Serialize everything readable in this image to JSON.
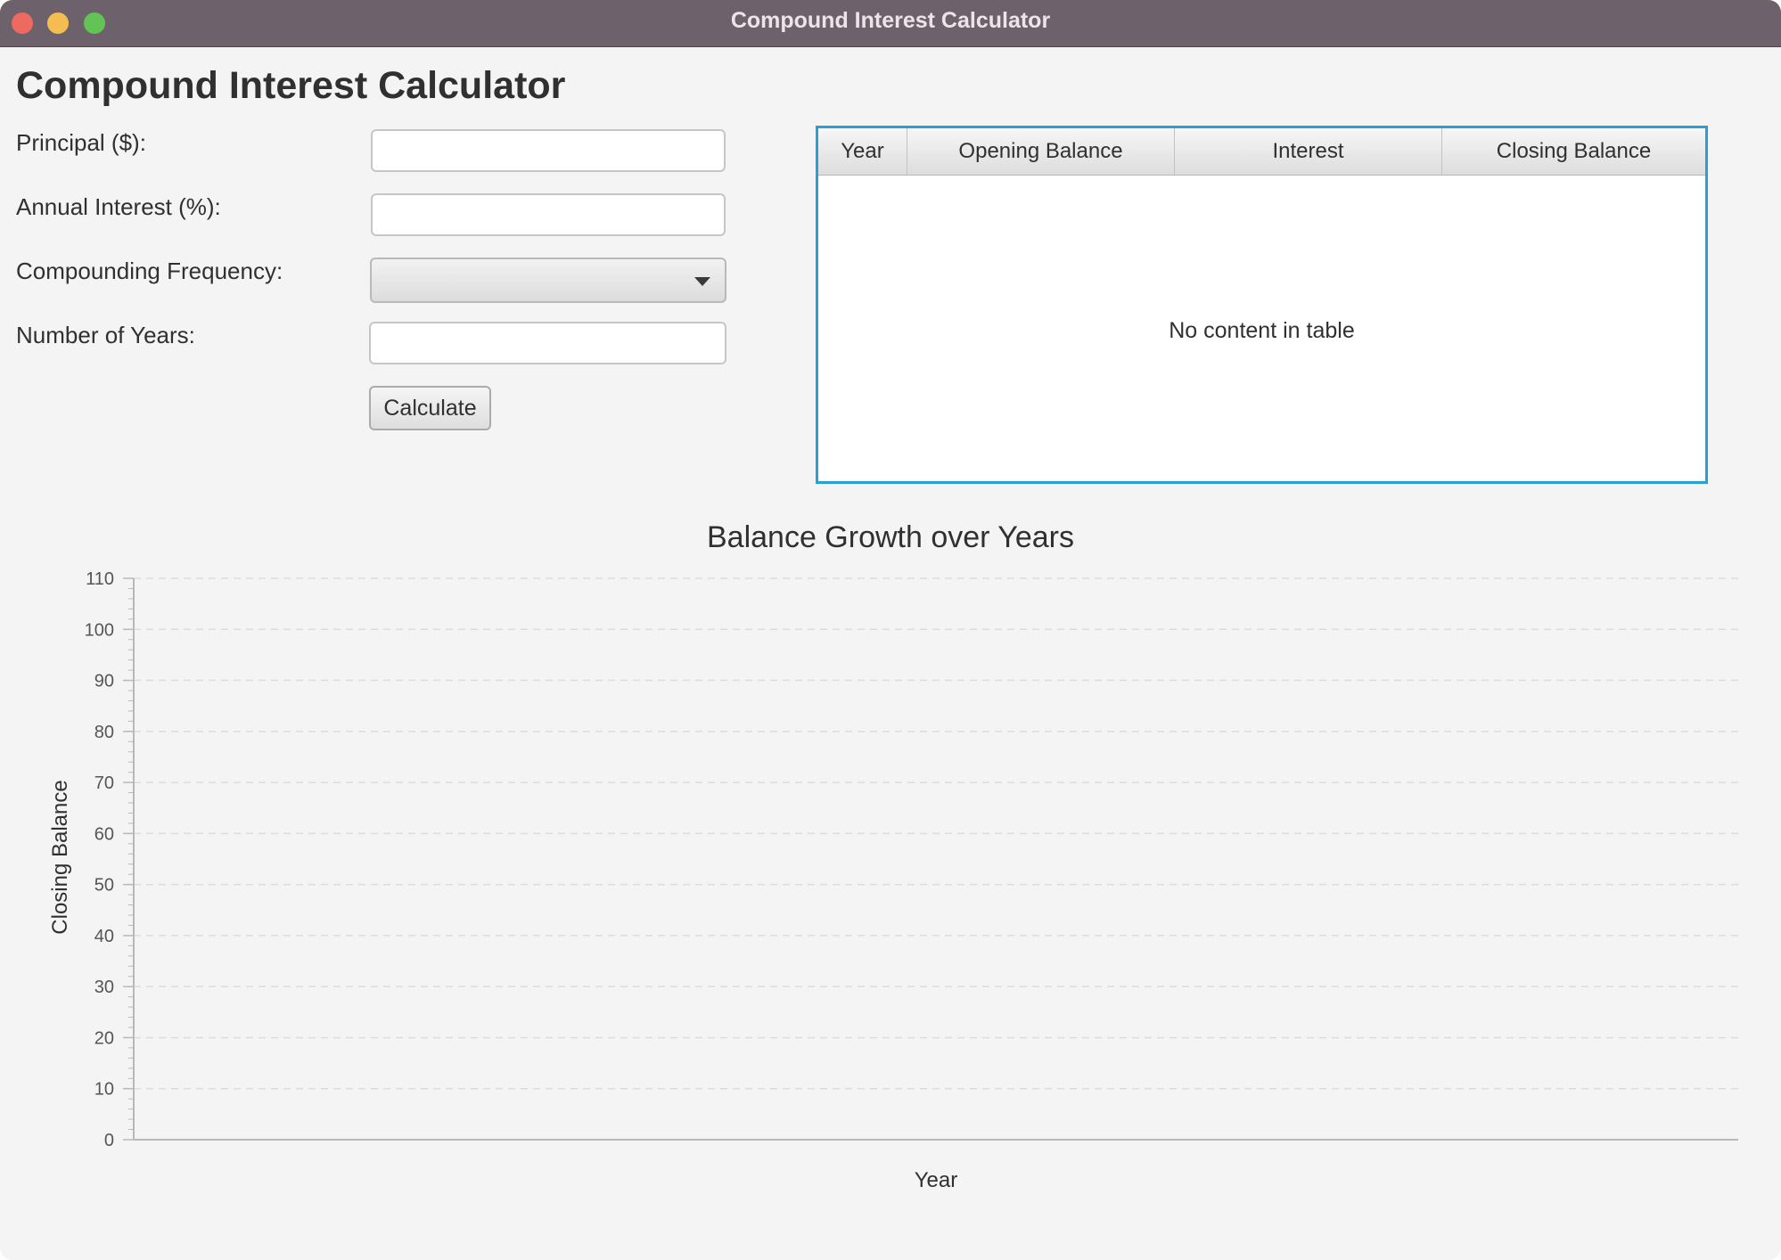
{
  "window": {
    "title": "Compound Interest Calculator"
  },
  "app": {
    "heading": "Compound Interest Calculator"
  },
  "form": {
    "principal_label": "Principal ($):",
    "principal_value": "",
    "interest_label": "Annual Interest (%):",
    "interest_value": "",
    "frequency_label": "Compounding Frequency:",
    "frequency_value": "",
    "years_label": "Number of Years:",
    "years_value": "",
    "calculate_label": "Calculate"
  },
  "table": {
    "columns": [
      "Year",
      "Opening Balance",
      "Interest",
      "Closing Balance"
    ],
    "rows": [],
    "empty_message": "No content in table"
  },
  "chart_data": {
    "type": "line",
    "title": "Balance Growth over Years",
    "xlabel": "Year",
    "ylabel": "Closing Balance",
    "ylim": [
      0,
      110
    ],
    "yticks": [
      0,
      10,
      20,
      30,
      40,
      50,
      60,
      70,
      80,
      90,
      100,
      110
    ],
    "series": [],
    "grid": true,
    "colors": {
      "grid": "#dcdcdc",
      "axis": "#b8b8b8",
      "tick_text": "#555555"
    }
  }
}
